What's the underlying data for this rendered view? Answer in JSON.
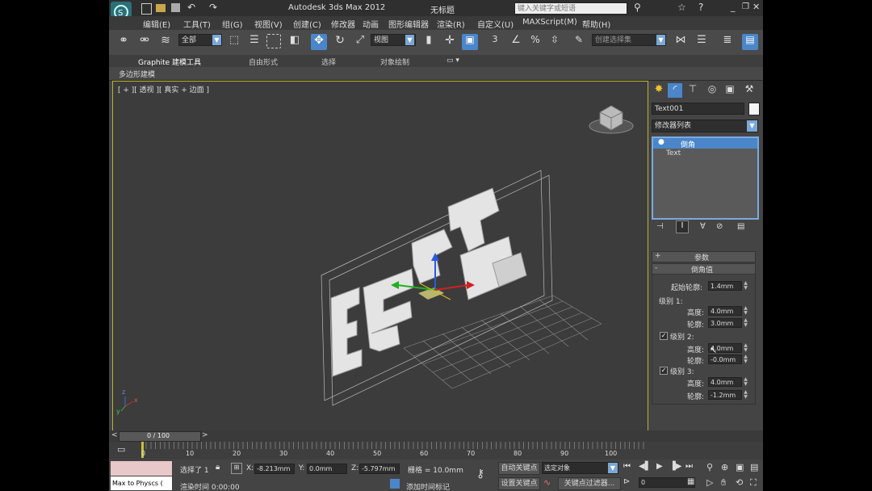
{
  "window": {
    "app_title": "Autodesk 3ds Max  2012",
    "doc_title": "无标题",
    "search_placeholder": "键入关键字或短语"
  },
  "menu": [
    "编辑(E)",
    "工具(T)",
    "组(G)",
    "视图(V)",
    "创建(C)",
    "修改器",
    "动画",
    "图形编辑器",
    "渲染(R)",
    "自定义(U)",
    "MAXScript(M)",
    "帮助(H)"
  ],
  "toolbar": {
    "selection_filter": "全部",
    "ref_coord": "视图",
    "named_selection": "创建选择集",
    "snap_label": "3"
  },
  "ribbon": {
    "tabs": [
      "Graphite 建模工具",
      "自由形式",
      "选择",
      "对象绘制"
    ],
    "sub_label": "多边形建模"
  },
  "viewport": {
    "label": "[ + ][ 透视 ][ 真实 + 边面 ]",
    "axis_x": "x",
    "axis_y": "y",
    "axis_z": "z"
  },
  "command_panel": {
    "object_name": "Text001",
    "modifier_list": "修改器列表",
    "stack": [
      "倒角",
      "Text"
    ],
    "rollout_params": "参数",
    "rollout_bevel": "倒角值",
    "start_outline_label": "起始轮廓:",
    "start_outline": "1.4mm",
    "level1_label": "级别 1:",
    "level1_height_label": "高度:",
    "level1_height": "4.0mm",
    "level1_outline_label": "轮廓:",
    "level1_outline": "3.0mm",
    "level2_label": "级别 2:",
    "level2_height_label": "高度:",
    "level2_height": "4.0mm",
    "level2_outline_label": "轮廓:",
    "level2_outline": "-0.0mm",
    "level3_label": "级别 3:",
    "level3_height_label": "高度:",
    "level3_height": "4.0mm",
    "level3_outline_label": "轮廓:",
    "level3_outline": "-1.2mm"
  },
  "timeline": {
    "frame_display": "0 / 100",
    "ticks": [
      "0",
      "10",
      "20",
      "30",
      "40",
      "50",
      "60",
      "70",
      "80",
      "90",
      "100"
    ]
  },
  "status": {
    "maxscript": "Max to Physcs (",
    "selected": "选择了 1",
    "x_label": "X:",
    "x_value": "-8.213mm",
    "y_label": "Y:",
    "y_value": "0.0mm",
    "z_label": "Z:",
    "z_value": "-5.797mm",
    "grid": "栅格 = 10.0mm",
    "auto_key": "自动关键点",
    "selected_object": "选定对象",
    "set_key": "设置关键点",
    "key_filter": "关键点过滤器...",
    "render_time": "渲染时间  0:00:00",
    "add_time_tag": "添加时间标记",
    "frame_value": "0"
  }
}
